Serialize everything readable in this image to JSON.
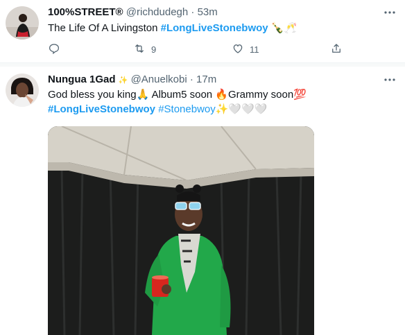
{
  "tweets": [
    {
      "display_name": "100%STREET®",
      "handle": "@richdudegh",
      "time": "53m",
      "text_plain": "The Life Of A Livingston ",
      "hashtag": "#LongLiveStonebwoy",
      "text_emoji": " 🍾🥂",
      "retweets": "9",
      "likes": "11"
    },
    {
      "display_name": "Nungua 1Gad",
      "name_badge": "✨",
      "handle": "@Anuelkobi",
      "time": "17m",
      "line1": "God bless you king🙏 Album5 soon 🔥Grammy soon💯",
      "hashtag1": "#LongLiveStonebwoy",
      "hashtag2": "#Stonebwoy",
      "line2_emoji": "✨🤍🤍🤍"
    }
  ],
  "icons": {
    "more": "more-horizontal-icon",
    "reply": "reply-icon",
    "retweet": "retweet-icon",
    "like": "heart-icon",
    "share": "share-icon"
  },
  "colors": {
    "link": "#1d9bf0",
    "meta": "#536471",
    "text": "#0f1419",
    "jacket": "#22a84a"
  }
}
